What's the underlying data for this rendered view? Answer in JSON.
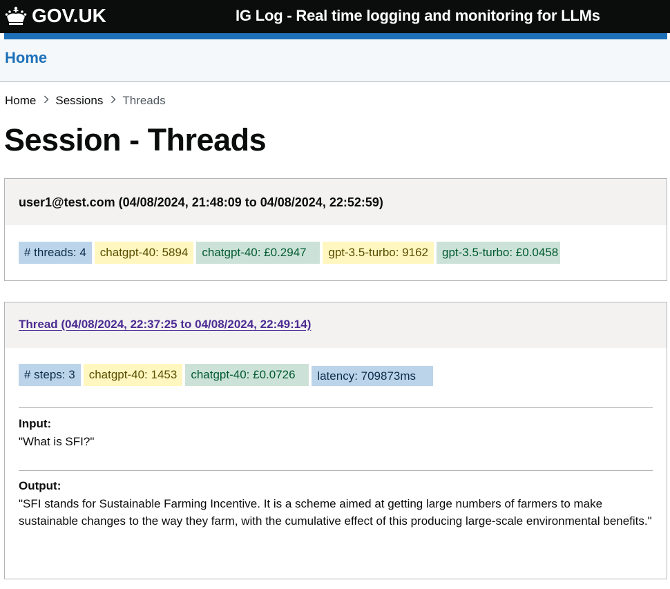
{
  "header": {
    "logo_text": "GOV.UK",
    "service_title": "IG Log - Real time logging and monitoring for LLMs"
  },
  "nav": {
    "home": "Home"
  },
  "breadcrumbs": {
    "items": [
      "Home",
      "Sessions"
    ],
    "current": "Threads"
  },
  "page_title": "Session - Threads",
  "session": {
    "title": "user1@test.com (04/08/2024, 21:48:09 to 04/08/2024, 22:52:59)",
    "tags": [
      {
        "text": "# threads: 4",
        "color": "#bbd4ea"
      },
      {
        "text": "chatgpt-40: 5894",
        "color": "#fff7bf"
      },
      {
        "text": "chatgpt-40: £0.2947",
        "color": "#cce2d8"
      },
      {
        "text": "gpt-3.5-turbo: 9162",
        "color": "#fff7bf"
      },
      {
        "text": "gpt-3.5-turbo: £0.0458",
        "color": "#cce2d8"
      }
    ]
  },
  "thread": {
    "link": "Thread (04/08/2024, 22:37:25 to 04/08/2024, 22:49:14)",
    "tags": [
      {
        "text": "# steps: 3",
        "color": "#bbd4ea"
      },
      {
        "text": "chatgpt-40: 1453",
        "color": "#fff7bf"
      },
      {
        "text": "chatgpt-40: £0.0726",
        "color": "#cce2d8"
      },
      {
        "text": "latency: 709873ms",
        "color": "#bbd4ea"
      }
    ],
    "input_label": "Input:",
    "input_text": "\"What is SFI?\"",
    "output_label": "Output:",
    "output_text": "\"SFI stands for Sustainable Farming Incentive. It is a scheme aimed at getting large numbers of farmers to make sustainable changes to the way they farm, with the cumulative effect of this producing large-scale environmental benefits.\""
  }
}
